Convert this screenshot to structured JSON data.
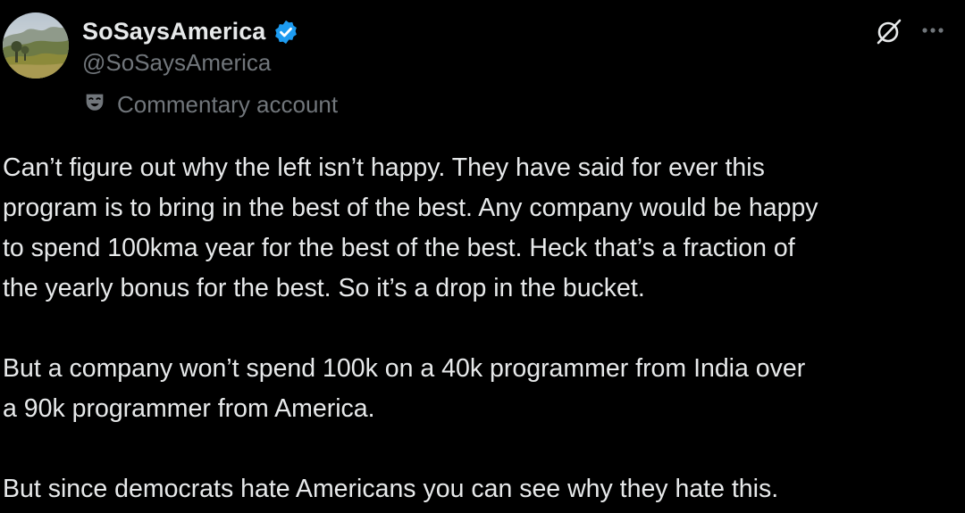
{
  "author": {
    "display_name": "SoSaysAmerica",
    "handle": "@SoSaysAmerica",
    "verified": true,
    "label": "Commentary account",
    "label_icon": "theater-mask-icon"
  },
  "actions": {
    "grok_icon": "grok-icon",
    "more_icon": "more-options-icon"
  },
  "tweet": {
    "paragraphs": [
      "Can’t figure out why the left isn’t happy. They have said for ever this\nprogram is to bring in the best of the best. Any company would be happy\nto spend 100kma year for the best of the best. Heck that’s a fraction of\nthe yearly bonus for the best. So it’s a drop in the bucket.",
      "But a company won’t spend 100k on a 40k programmer from India over\na 90k programmer from America.",
      "But since democrats hate Americans you can see why they hate this."
    ]
  },
  "colors": {
    "background": "#000000",
    "primary_text": "#e7e9ea",
    "secondary_text": "#71767b",
    "verified_blue": "#1d9bf0"
  }
}
